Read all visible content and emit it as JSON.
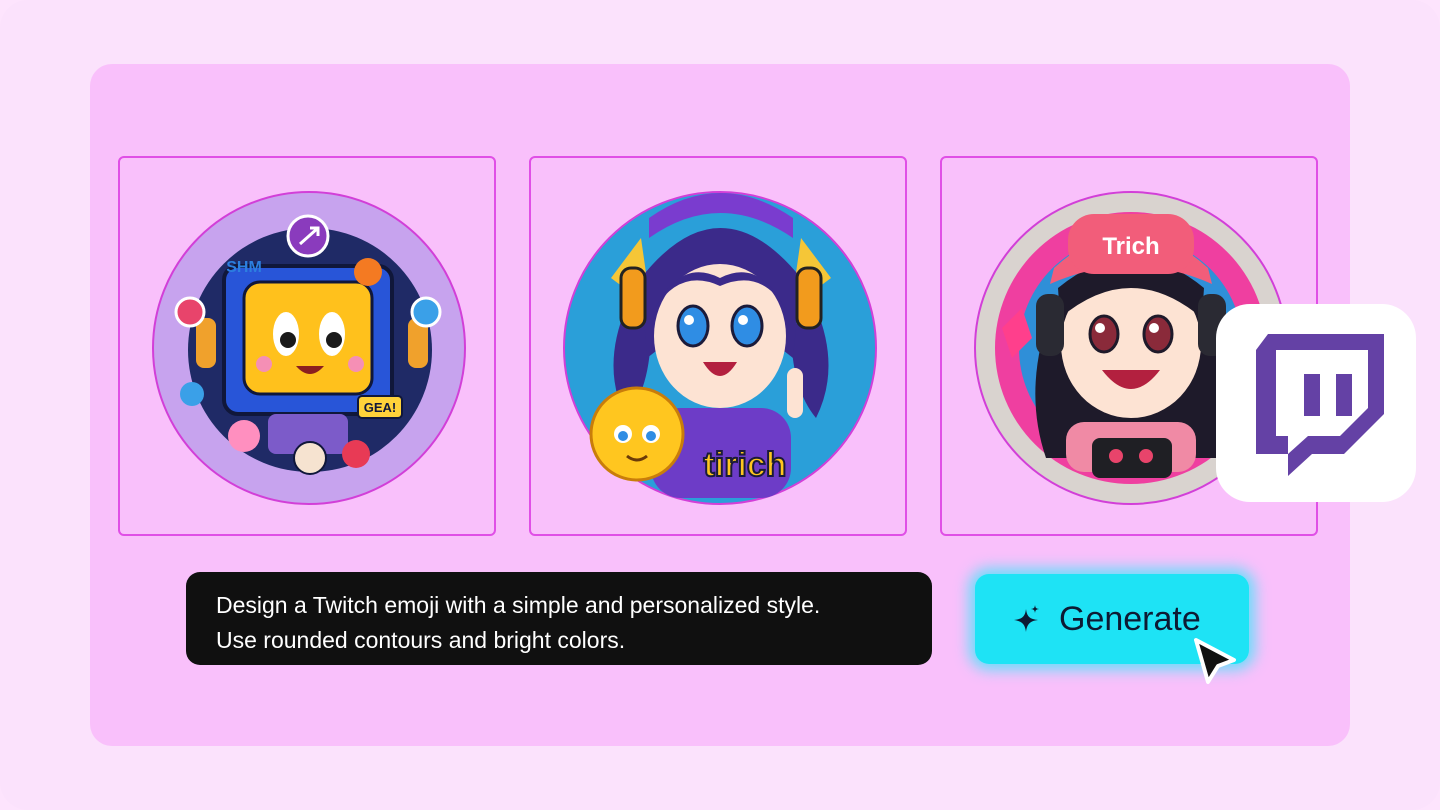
{
  "prompt": {
    "line1": "Design a Twitch emoji with a simple and personalized style.",
    "line2": "Use rounded contours and bright colors."
  },
  "generate_button": {
    "label": "Generate",
    "icon": "sparkle-icon"
  },
  "cards": [
    {
      "name": "tv-mascot-emoji",
      "badge_text": "GEA!",
      "side_text": "SHM"
    },
    {
      "name": "anime-girl-emoji",
      "logo_text": "tirich"
    },
    {
      "name": "cap-girl-emoji",
      "cap_text": "Trich"
    }
  ],
  "brand": {
    "name": "twitch-logo-icon",
    "color": "#6441a5"
  },
  "colors": {
    "background": "#fbe2fc",
    "panel": "#f9c0fb",
    "card_border": "#e04fe6",
    "button": "#1ee3f5",
    "prompt_bg": "#101010"
  }
}
